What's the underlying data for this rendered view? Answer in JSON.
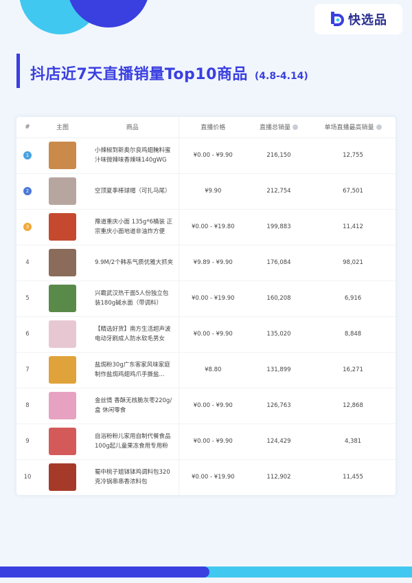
{
  "brand": {
    "name": "快选品",
    "colors": {
      "primary": "#3a3fe0",
      "secondary": "#41c8f0"
    }
  },
  "title": {
    "main": "抖店近7天直播销量Top10商品",
    "range": "(4.8-4.14)"
  },
  "table": {
    "headers": {
      "rank": "#",
      "image": "主图",
      "product": "商品",
      "price": "直播价格",
      "total_sales": "直播总销量",
      "max_sales": "单场直播最高销量"
    },
    "rows": [
      {
        "rank": "1",
        "name": "小辣椒到新奥尔良鸡翅腌料蜜汁味微辣味香辣味140gWG",
        "price": "¥0.00 - ¥9.90",
        "total": "216,150",
        "max": "12,755",
        "badge": "#4aa3df",
        "thumb": "#c98a4a"
      },
      {
        "rank": "2",
        "name": "空顶夏季棒球帽（可扎马尾）",
        "price": "¥9.90",
        "total": "212,754",
        "max": "67,501",
        "badge": "#4a78d8",
        "thumb": "#b7a6a0"
      },
      {
        "rank": "3",
        "name": "豫道重庆小面 135g*6桶装 正宗重庆小面地道非油炸方便",
        "price": "¥0.00 - ¥19.80",
        "total": "199,883",
        "max": "11,412",
        "badge": "#f0a93b",
        "thumb": "#c4492e"
      },
      {
        "rank": "4",
        "name": "9.9M/2个韩系气质优雅大抓夹",
        "price": "¥9.89 - ¥9.90",
        "total": "176,084",
        "max": "98,021",
        "badge": "",
        "thumb": "#8b6b5a"
      },
      {
        "rank": "5",
        "name": "兴霸武汉热干面5人份独立包装180g碱水面（带调料）",
        "price": "¥0.00 - ¥19.90",
        "total": "160,208",
        "max": "6,916",
        "badge": "",
        "thumb": "#5a8a4a"
      },
      {
        "rank": "6",
        "name": "【精选好货】南方生活超声波电动牙刷成人防水软毛男女",
        "price": "¥0.00 - ¥9.90",
        "total": "135,020",
        "max": "8,848",
        "badge": "",
        "thumb": "#e7c8d2"
      },
      {
        "rank": "7",
        "name": "盐焗粉30g广东客家风味家庭制作盐焗鸡翅鸡爪手撕盐...",
        "price": "¥8.80",
        "total": "131,899",
        "max": "16,271",
        "badge": "",
        "thumb": "#e0a23a"
      },
      {
        "rank": "8",
        "name": "金丝情 香酥无核脆灰枣220g/盒 休闲零食",
        "price": "¥0.00 - ¥9.90",
        "total": "126,763",
        "max": "12,868",
        "badge": "",
        "thumb": "#e6a2c0"
      },
      {
        "rank": "9",
        "name": "自浴粉粉儿家用自制代餐食品100g起儿童果冻食用专用粉",
        "price": "¥0.00 - ¥9.90",
        "total": "124,429",
        "max": "4,381",
        "badge": "",
        "thumb": "#d45a5a"
      },
      {
        "rank": "10",
        "name": "蜀中桃子姐钵钵鸡调料包320克冷锅串串香浓料包",
        "price": "¥0.00 - ¥19.90",
        "total": "112,902",
        "max": "11,455",
        "badge": "",
        "thumb": "#a63a2a"
      }
    ]
  }
}
